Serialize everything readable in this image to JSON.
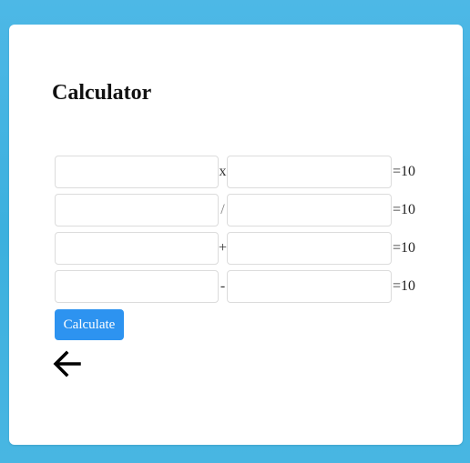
{
  "page": {
    "title": "Calculator"
  },
  "colors": {
    "background": "#3cb0de",
    "card": "#ffffff",
    "button": "#2d93f0",
    "button_text": "#ffffff"
  },
  "rows": [
    {
      "operator": "x",
      "first_value": "",
      "second_value": "",
      "result": "=10"
    },
    {
      "operator": "/",
      "first_value": "",
      "second_value": "",
      "result": "=10"
    },
    {
      "operator": "+",
      "first_value": "",
      "second_value": "",
      "result": "=10"
    },
    {
      "operator": "-",
      "first_value": "",
      "second_value": "",
      "result": "=10"
    }
  ],
  "actions": {
    "calculate_label": "Calculate",
    "back_icon": "arrow-left-icon"
  }
}
